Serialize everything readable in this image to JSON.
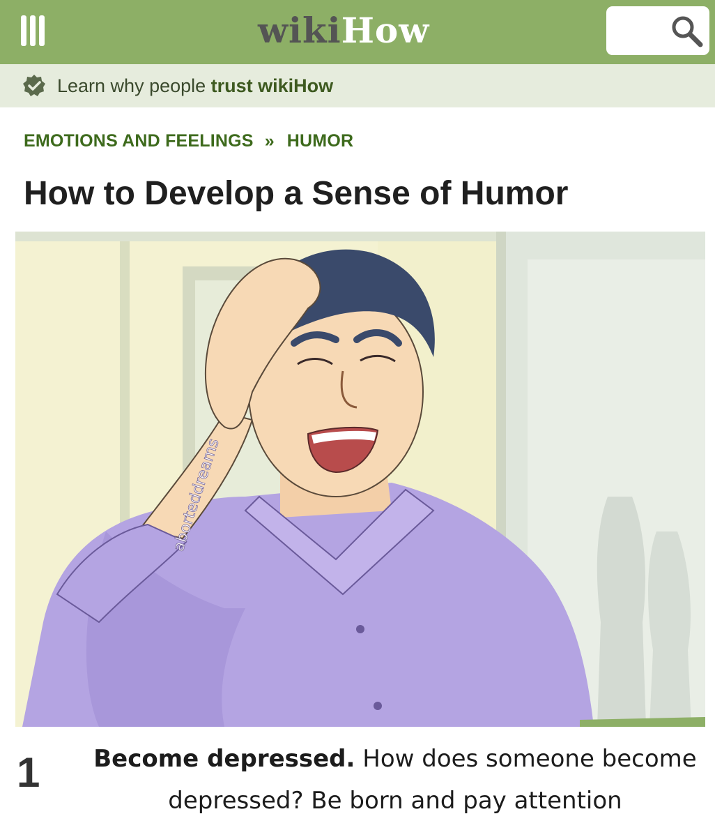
{
  "header": {
    "logo_wiki": "wiki",
    "logo_how": "How",
    "colors": {
      "bar": "#8daf66",
      "logo_dark": "#545454"
    },
    "menu_icon": "hamburger-menu-icon",
    "search_icon": "magnifier-icon"
  },
  "trust": {
    "icon": "verified-badge-icon",
    "text_plain": "Learn why people ",
    "text_strong": "trust wikiHow"
  },
  "breadcrumb": {
    "items": [
      "EMOTIONS AND FEELINGS",
      "HUMOR"
    ],
    "separator": "»"
  },
  "article": {
    "title": "How to Develop a Sense of Humor"
  },
  "illustration": {
    "watermark": "aborteddreams"
  },
  "step": {
    "number": "1",
    "headline": "Become depressed.",
    "body": "How does someone become depressed? Be born and pay attention"
  }
}
